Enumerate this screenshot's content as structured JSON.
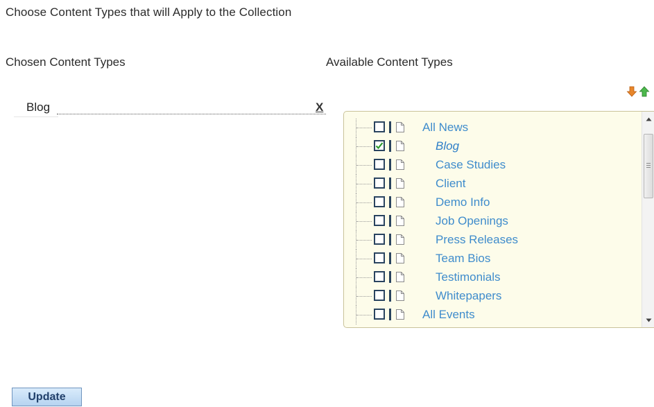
{
  "page": {
    "heading": "Choose Content Types that will Apply to the Collection"
  },
  "chosen": {
    "heading": "Chosen Content Types",
    "items": [
      {
        "label": "Blog",
        "remove_label": "X"
      }
    ]
  },
  "available": {
    "heading": "Available Content Types",
    "sort_icons": [
      "move-down-arrow-icon",
      "move-up-arrow-icon"
    ],
    "items": [
      {
        "label": "All News",
        "level": 0,
        "checked": false
      },
      {
        "label": "Blog",
        "level": 1,
        "checked": true
      },
      {
        "label": "Case Studies",
        "level": 1,
        "checked": false
      },
      {
        "label": "Client",
        "level": 1,
        "checked": false
      },
      {
        "label": "Demo Info",
        "level": 1,
        "checked": false
      },
      {
        "label": "Job Openings",
        "level": 1,
        "checked": false
      },
      {
        "label": "Press Releases",
        "level": 1,
        "checked": false
      },
      {
        "label": "Team Bios",
        "level": 1,
        "checked": false
      },
      {
        "label": "Testimonials",
        "level": 1,
        "checked": false
      },
      {
        "label": "Whitepapers",
        "level": 1,
        "checked": false
      },
      {
        "label": "All Events",
        "level": 0,
        "checked": false
      }
    ]
  },
  "actions": {
    "update_label": "Update"
  },
  "colors": {
    "link": "#3f8ccc",
    "tree_background": "#fdfcea",
    "checkbox_border": "#29435f",
    "check_mark": "#2a9a2a",
    "arrow_down": "#e07a1f",
    "arrow_up": "#3aa83a"
  }
}
